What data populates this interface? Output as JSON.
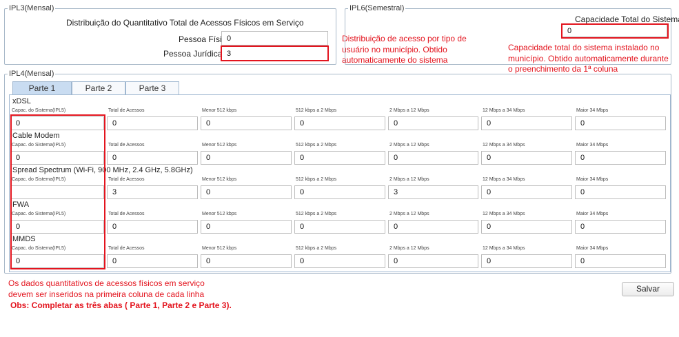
{
  "ipl3": {
    "legend": "IPL3(Mensal)",
    "title": "Distribuição do Quantitativo Total de Acessos Físicos em Serviço",
    "pf_label": "Pessoa Física:",
    "pf_value": "0",
    "pj_label": "Pessoa Jurídica:",
    "pj_value": "3"
  },
  "ipl6": {
    "legend": "IPL6(Semestral)",
    "cap_label": "Capacidade Total do Sistema:",
    "cap_value": "0"
  },
  "notes": {
    "distrib": [
      "Distribuição de acesso por tipo de",
      "usuário no município. Obtido",
      "automaticamente do sistema"
    ],
    "capacidade": [
      "Capacidade total do sistema instalado no",
      "município. Obtido automaticamente durante",
      "o preenchimento da 1ª coluna"
    ],
    "bottom": [
      " Os dados quantitativos de acessos físicos em serviço",
      "  devem ser inseridos na primeira coluna de cada linha"
    ],
    "obs": "Obs: Completar as três abas ( Parte 1, Parte 2 e Parte 3)."
  },
  "ipl4": {
    "legend": "IPL4(Mensal)",
    "tabs": [
      "Parte 1",
      "Parte 2",
      "Parte 3"
    ],
    "column_headers": [
      "Capac. do Sistema(IPL5)",
      "Total de Acessos",
      "Menor 512 kbps",
      "512 kbps a 2 Mbps",
      "2 Mbps a 12 Mbps",
      "12 Mbps a 34 Mbps",
      "Maior 34 Mbps"
    ],
    "sections": [
      {
        "title": "xDSL",
        "values": [
          "0",
          "0",
          "0",
          "0",
          "0",
          "0",
          "0"
        ]
      },
      {
        "title": "Cable Modem",
        "values": [
          "0",
          "0",
          "0",
          "0",
          "0",
          "0",
          "0"
        ]
      },
      {
        "title": "Spread Spectrum (Wi-Fi, 900 MHz, 2.4 GHz, 5.8GHz)",
        "values": [
          "",
          "3",
          "0",
          "0",
          "3",
          "0",
          "0"
        ]
      },
      {
        "title": "FWA",
        "values": [
          "0",
          "0",
          "0",
          "0",
          "0",
          "0",
          "0"
        ]
      },
      {
        "title": "MMDS",
        "values": [
          "0",
          "0",
          "0",
          "0",
          "0",
          "0",
          "0"
        ]
      }
    ]
  },
  "actions": {
    "save_label": "Salvar"
  }
}
